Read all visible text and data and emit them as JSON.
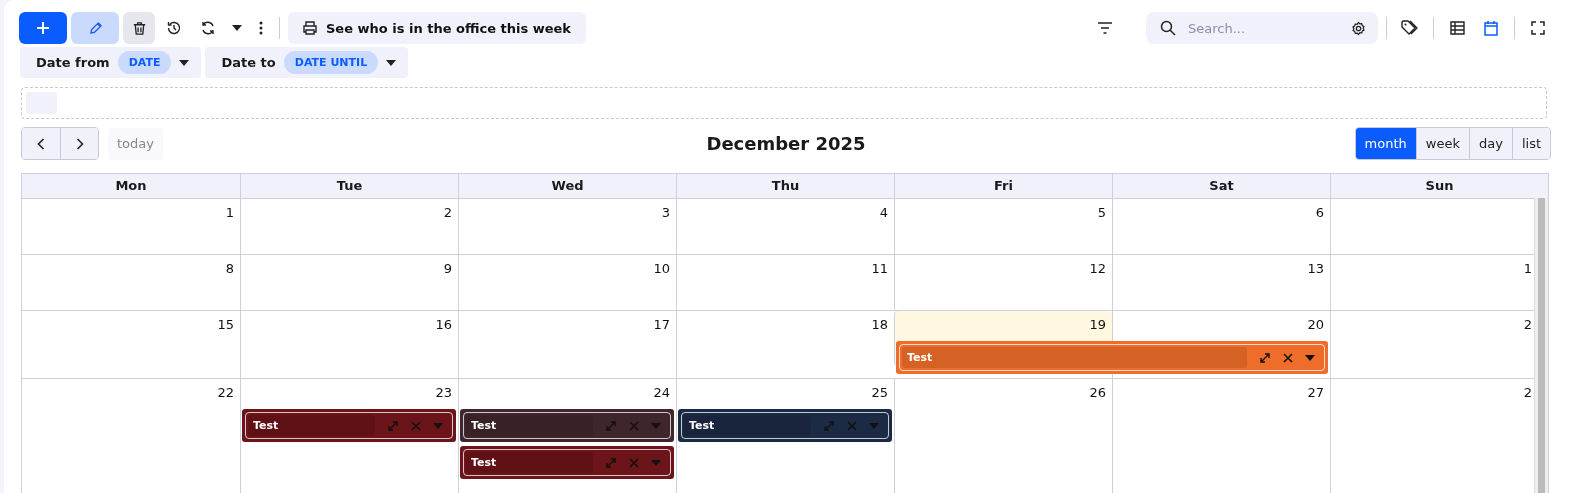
{
  "toolbar": {
    "print_button": "See who is in the office this week",
    "search": {
      "placeholder": "Search..."
    },
    "views": [
      {
        "kind": "table",
        "selected": false
      },
      {
        "kind": "calendar",
        "selected": true
      }
    ]
  },
  "filters": [
    {
      "label": "Date from",
      "value": "DATE"
    },
    {
      "label": "Date to",
      "value": "DATE UNTIL"
    }
  ],
  "calendar": {
    "title": "December 2025",
    "today_button": {
      "label": "today",
      "disabled": true
    },
    "views": [
      {
        "label": "month",
        "selected": true
      },
      {
        "label": "week",
        "selected": false
      },
      {
        "label": "day",
        "selected": false
      },
      {
        "label": "list",
        "selected": false
      }
    ],
    "weekdays": [
      "Mon",
      "Tue",
      "Wed",
      "Thu",
      "Fri",
      "Sat",
      "Sun"
    ],
    "weeks": [
      {
        "days": [
          {
            "number": "1",
            "today": false
          },
          {
            "number": "2",
            "today": false
          },
          {
            "number": "3",
            "today": false
          },
          {
            "number": "4",
            "today": false
          },
          {
            "number": "5",
            "today": false
          },
          {
            "number": "6",
            "today": false
          },
          {
            "today": false
          }
        ]
      },
      {
        "days": [
          {
            "number": "8",
            "today": false
          },
          {
            "number": "9",
            "today": false
          },
          {
            "number": "10",
            "today": false
          },
          {
            "number": "11",
            "today": false
          },
          {
            "number": "12",
            "today": false
          },
          {
            "number": "13",
            "today": false
          },
          {
            "number": "1",
            "today": false
          }
        ]
      },
      {
        "days": [
          {
            "number": "15",
            "today": false
          },
          {
            "number": "16",
            "today": false
          },
          {
            "number": "17",
            "today": false
          },
          {
            "number": "18",
            "today": false
          },
          {
            "number": "19",
            "today": true,
            "events": [
              {
                "title": "Test",
                "color": "#ee6d2a",
                "continues_to_next_day": true
              }
            ]
          },
          {
            "number": "20",
            "today": false
          },
          {
            "number": "2",
            "today": false
          }
        ]
      },
      {
        "days": [
          {
            "number": "22",
            "today": false
          },
          {
            "number": "23",
            "today": false,
            "events": [
              {
                "title": "Test",
                "color": "#6b1419",
                "continues_to_next_day": false
              }
            ]
          },
          {
            "number": "24",
            "today": false,
            "events": [
              {
                "title": "Test",
                "color": "#3f252c",
                "continues_to_next_day": false
              },
              {
                "title": "Test",
                "color": "#6b1419",
                "continues_to_next_day": false
              }
            ]
          },
          {
            "number": "25",
            "today": false,
            "events": [
              {
                "title": "Test",
                "color": "#1b2a45",
                "continues_to_next_day": false
              }
            ]
          },
          {
            "number": "26",
            "today": false
          },
          {
            "number": "27",
            "today": false
          },
          {
            "number": "2",
            "today": false
          }
        ]
      }
    ]
  }
}
